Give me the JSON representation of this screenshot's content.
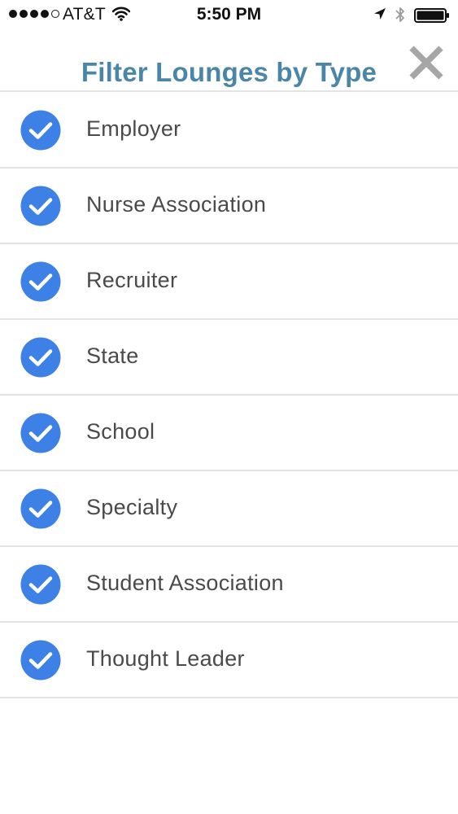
{
  "status_bar": {
    "carrier": "AT&T",
    "time": "5:50 PM",
    "signal_bars_filled": 4,
    "signal_bars_total": 5,
    "icons": [
      "signal-dots",
      "wifi-icon",
      "location-arrow-icon",
      "bluetooth-icon",
      "battery-icon"
    ]
  },
  "header": {
    "title": "Filter Lounges by Type",
    "close_icon": "close-x-icon"
  },
  "filters": [
    {
      "label": "Employer",
      "checked": true
    },
    {
      "label": "Nurse Association",
      "checked": true
    },
    {
      "label": "Recruiter",
      "checked": true
    },
    {
      "label": "State",
      "checked": true
    },
    {
      "label": "School",
      "checked": true
    },
    {
      "label": "Specialty",
      "checked": true
    },
    {
      "label": "Student Association",
      "checked": true
    },
    {
      "label": "Thought Leader",
      "checked": true
    }
  ],
  "colors": {
    "title": "#4a86a8",
    "check_fill": "#3d80e6",
    "label_text": "#4a4a4a",
    "divider": "#e3e3e3",
    "close_icon": "#a6a6a6"
  }
}
